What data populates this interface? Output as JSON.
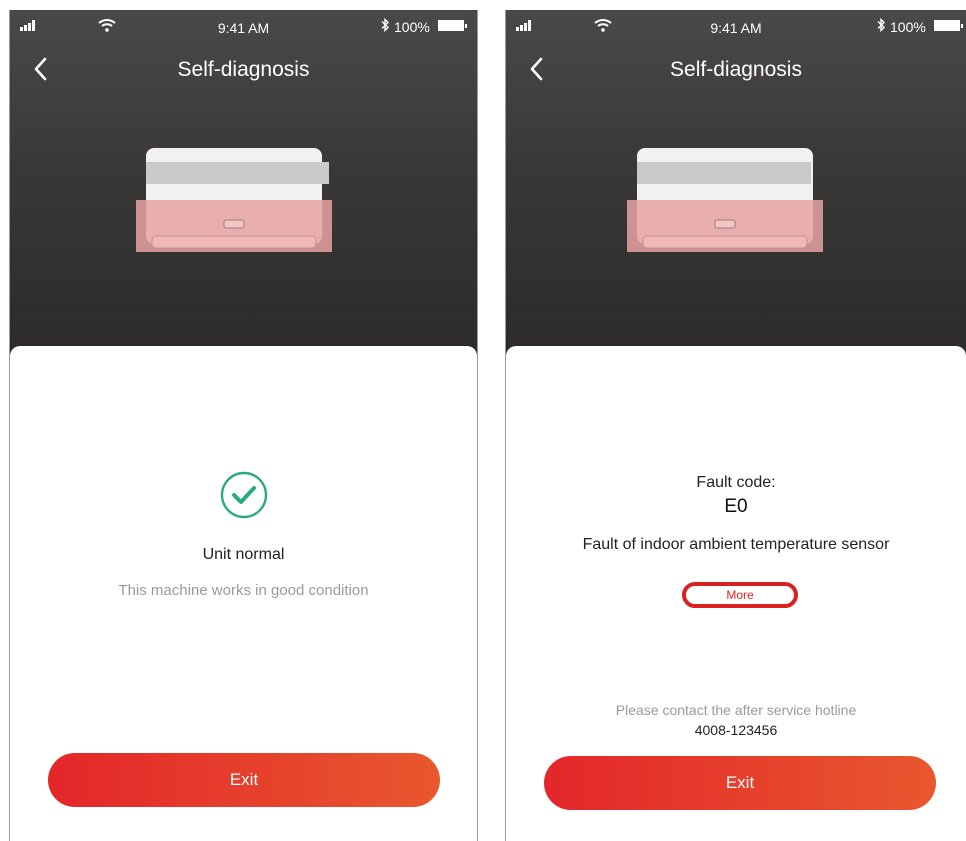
{
  "left_screen": {
    "status_bar": {
      "time": "9:41 AM",
      "battery": "100%"
    },
    "nav": {
      "title": "Self-diagnosis"
    },
    "result": {
      "title": "Unit normal",
      "subtitle": "This machine works in good condition"
    },
    "exit_label": "Exit"
  },
  "right_screen": {
    "status_bar": {
      "time": "9:41 AM",
      "battery": "100%"
    },
    "nav": {
      "title": "Self-diagnosis"
    },
    "fault": {
      "label": "Fault code:",
      "code": "E0",
      "description": "Fault of indoor ambient temperature sensor",
      "more_label": "More"
    },
    "hotline": {
      "label": "Please contact the after service hotline",
      "number": "4008-123456"
    },
    "exit_label": "Exit"
  },
  "colors": {
    "accent_red": "#e3262a",
    "accent_orange": "#e8572e",
    "check_green": "#2bab7a",
    "highlight_red": "#d92121"
  },
  "icons": [
    "signal-icon",
    "wifi-icon",
    "bluetooth-icon",
    "battery-icon",
    "back-chevron-icon",
    "checkmark-circle-icon",
    "air-conditioner-illustration"
  ]
}
